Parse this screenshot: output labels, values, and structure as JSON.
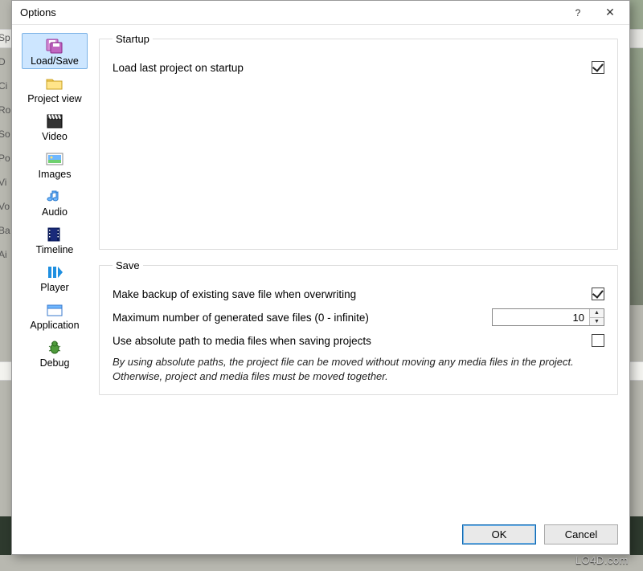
{
  "window": {
    "title": "Options",
    "help_label": "?",
    "close_label": "✕"
  },
  "sidebar": {
    "items": [
      {
        "id": "load-save",
        "label": "Load/Save"
      },
      {
        "id": "project-view",
        "label": "Project view"
      },
      {
        "id": "video",
        "label": "Video"
      },
      {
        "id": "images",
        "label": "Images"
      },
      {
        "id": "audio",
        "label": "Audio"
      },
      {
        "id": "timeline",
        "label": "Timeline"
      },
      {
        "id": "player",
        "label": "Player"
      },
      {
        "id": "application",
        "label": "Application"
      },
      {
        "id": "debug",
        "label": "Debug"
      }
    ]
  },
  "groups": {
    "startup": {
      "legend": "Startup",
      "load_last_label": "Load last project on startup",
      "load_last_checked": true
    },
    "save": {
      "legend": "Save",
      "backup_label": "Make backup of existing save file when overwriting",
      "backup_checked": true,
      "maxfiles_label": "Maximum number of generated save files (0 - infinite)",
      "maxfiles_value": "10",
      "abspath_label": "Use absolute path to media files when saving projects",
      "abspath_checked": false,
      "hint": "By using absolute paths, the project file can be moved without moving any media files in the project. Otherwise, project and media files must be moved together."
    }
  },
  "buttons": {
    "ok": "OK",
    "cancel": "Cancel"
  },
  "watermark": "LO4D.com"
}
